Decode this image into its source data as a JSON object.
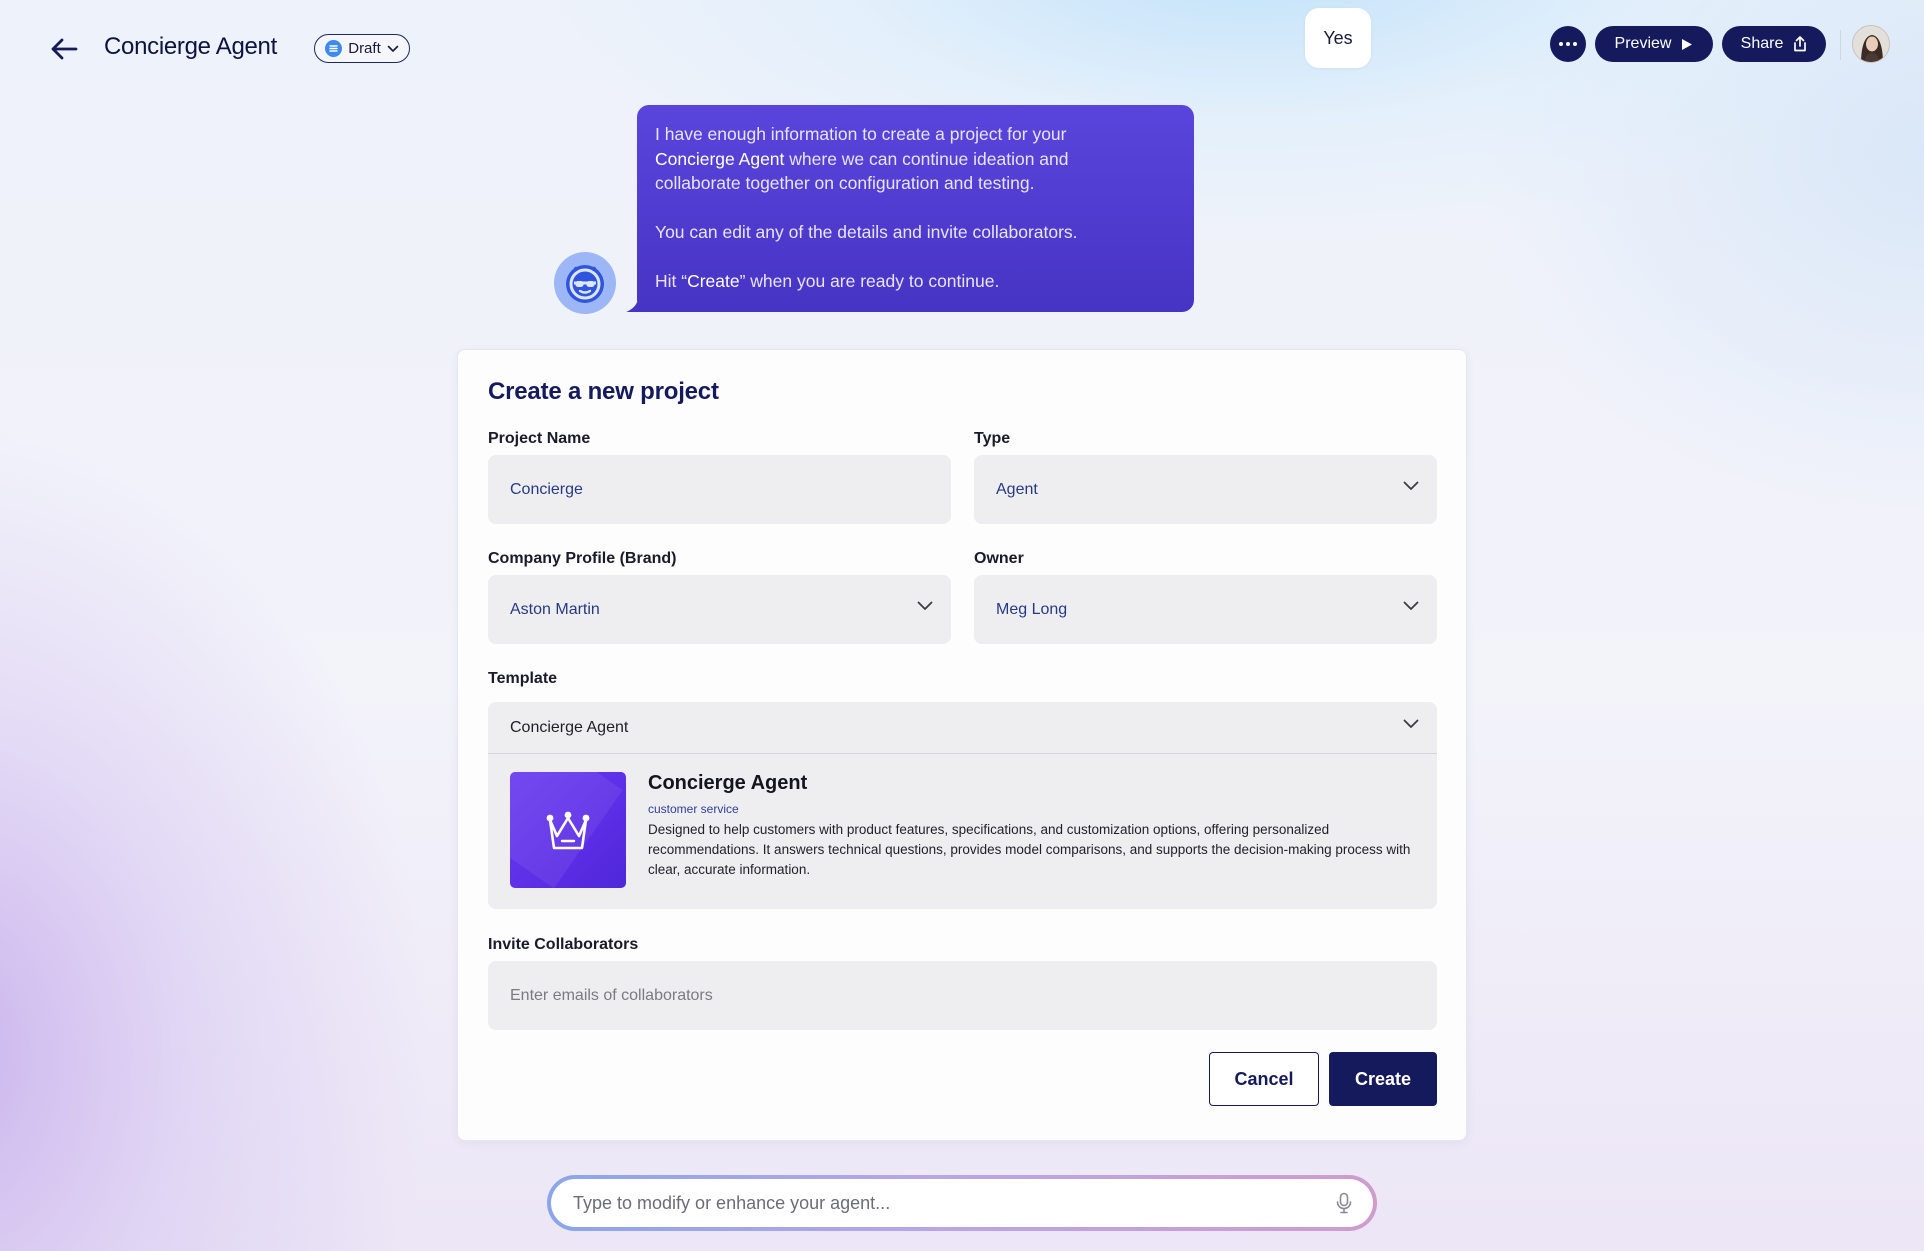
{
  "header": {
    "title": "Concierge Agent",
    "status_label": "Draft",
    "preview_label": "Preview",
    "share_label": "Share"
  },
  "chat": {
    "user_reply": "Yes",
    "agent_message": {
      "line1_pre": "I have enough information to create a project for your",
      "line2_highlight": "Concierge Agent",
      "line2_post": " where we can continue ideation and",
      "line3": "collaborate together on configuration and testing.",
      "para2": "You can edit any of the details and invite collaborators.",
      "para3_pre": "Hit “",
      "para3_highlight": "Create",
      "para3_post": "” when you are ready to continue."
    }
  },
  "form": {
    "title": "Create a new project",
    "project_name": {
      "label": "Project Name",
      "value": "Concierge"
    },
    "type": {
      "label": "Type",
      "value": "Agent"
    },
    "company_profile": {
      "label": "Company Profile (Brand)",
      "value": "Aston Martin"
    },
    "owner": {
      "label": "Owner",
      "value": "Meg Long"
    },
    "template": {
      "label": "Template",
      "value": "Concierge Agent",
      "card_name": "Concierge Agent",
      "card_tag": "customer service",
      "card_description": "Designed to help customers with product features, specifications, and customization options, offering personalized recommendations. It answers technical questions, provides model comparisons, and supports the decision-making process with clear, accurate information."
    },
    "collaborators": {
      "label": "Invite Collaborators",
      "placeholder": "Enter emails of collaborators"
    },
    "cancel_label": "Cancel",
    "create_label": "Create"
  },
  "prompt": {
    "placeholder": "Type to modify or enhance your agent..."
  },
  "colors": {
    "brand_navy": "#141a5c",
    "agent_bubble": "#4f3cd2",
    "template_purple": "#5c2ee6",
    "draft_blue": "#3d8bf0"
  },
  "icons": [
    "back-arrow-icon",
    "draft-status-icon",
    "chevron-down-icon",
    "more-icon",
    "play-icon",
    "share-icon",
    "bot-icon",
    "crown-icon",
    "microphone-icon"
  ]
}
